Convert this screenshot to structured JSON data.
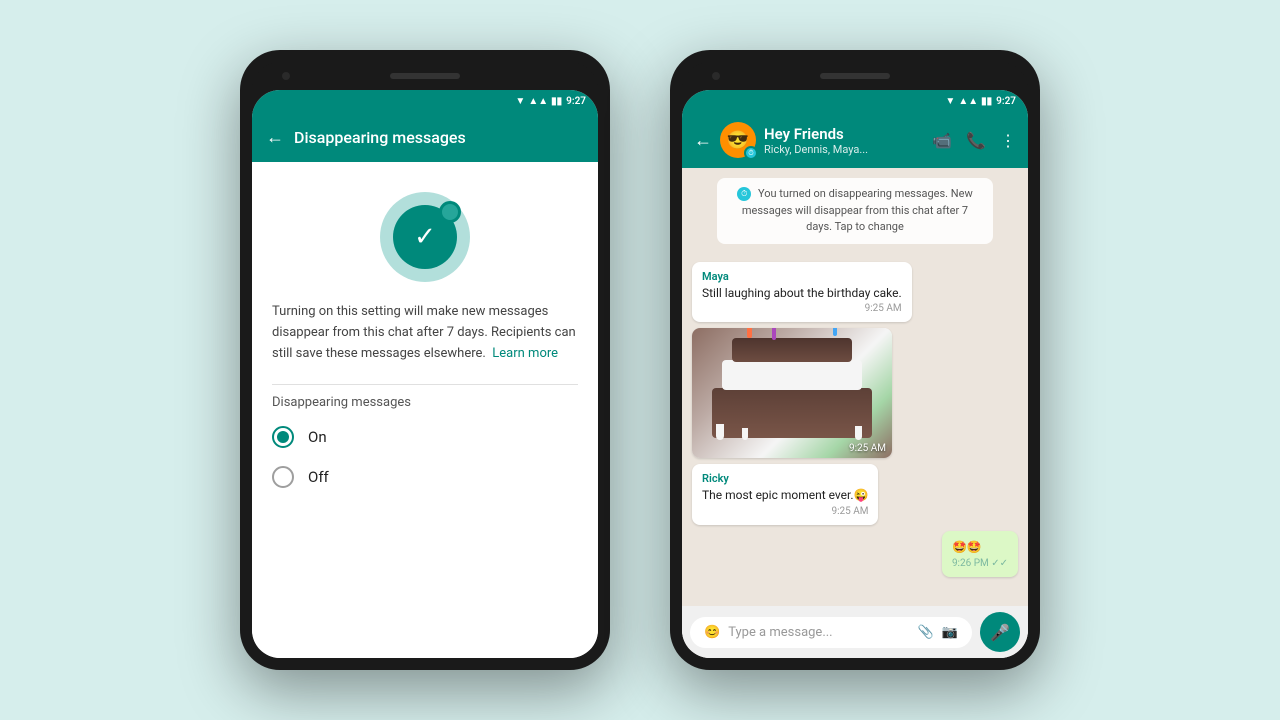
{
  "background_color": "#d6eeec",
  "phone1": {
    "status_bar": {
      "time": "9:27",
      "signal": "▲▲▲",
      "wifi": "▼",
      "battery": "▮▮▮"
    },
    "toolbar": {
      "back_icon": "←",
      "title": "Disappearing messages"
    },
    "description": "Turning on this setting will make new messages disappear from this chat after 7 days. Recipients can still save these messages elsewhere.",
    "learn_more": "Learn more",
    "section_label": "Disappearing messages",
    "options": [
      {
        "label": "On",
        "selected": true
      },
      {
        "label": "Off",
        "selected": false
      }
    ]
  },
  "phone2": {
    "status_bar": {
      "time": "9:27"
    },
    "toolbar": {
      "back_icon": "←",
      "group_name": "Hey Friends",
      "group_members": "Ricky, Dennis, Maya...",
      "video_icon": "▶",
      "call_icon": "📞",
      "more_icon": "⋮"
    },
    "system_message": "You turned on disappearing messages. New messages will disappear from this chat after 7 days. Tap to change",
    "messages": [
      {
        "sender": "Maya",
        "text": "Still laughing about the birthday cake.",
        "time": "9:25 AM",
        "type": "text",
        "sent": false
      },
      {
        "sender": null,
        "text": null,
        "time": "9:25 AM",
        "type": "image",
        "sent": false
      },
      {
        "sender": "Ricky",
        "text": "The most epic moment ever.😜",
        "time": "9:25 AM",
        "type": "text",
        "sent": false
      },
      {
        "sender": null,
        "text": "🤩🤩",
        "time": "9:26 PM",
        "type": "text",
        "sent": true,
        "ticks": "✓✓"
      }
    ],
    "input_placeholder": "Type a message...",
    "emoji_icon": "😊",
    "attach_icon": "📎",
    "camera_icon": "📷",
    "mic_icon": "🎤"
  }
}
